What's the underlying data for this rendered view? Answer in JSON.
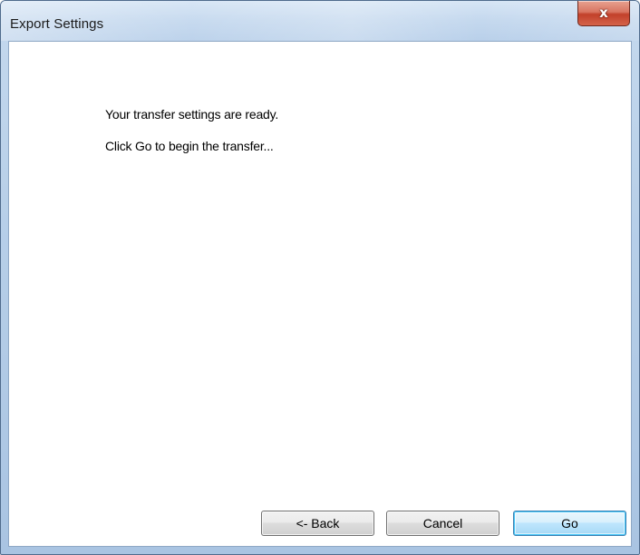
{
  "window": {
    "title": "Export Settings",
    "close_glyph": "x"
  },
  "content": {
    "line1": "Your transfer settings are ready.",
    "line2": "Click Go to begin the transfer..."
  },
  "buttons": {
    "back": "<- Back",
    "cancel": "Cancel",
    "go": "Go"
  },
  "colors": {
    "titlebar": "#c4d8ee",
    "close_button": "#c2402a",
    "default_button_border": "#3c7fb1"
  },
  "icons": {
    "close": "close-icon"
  }
}
